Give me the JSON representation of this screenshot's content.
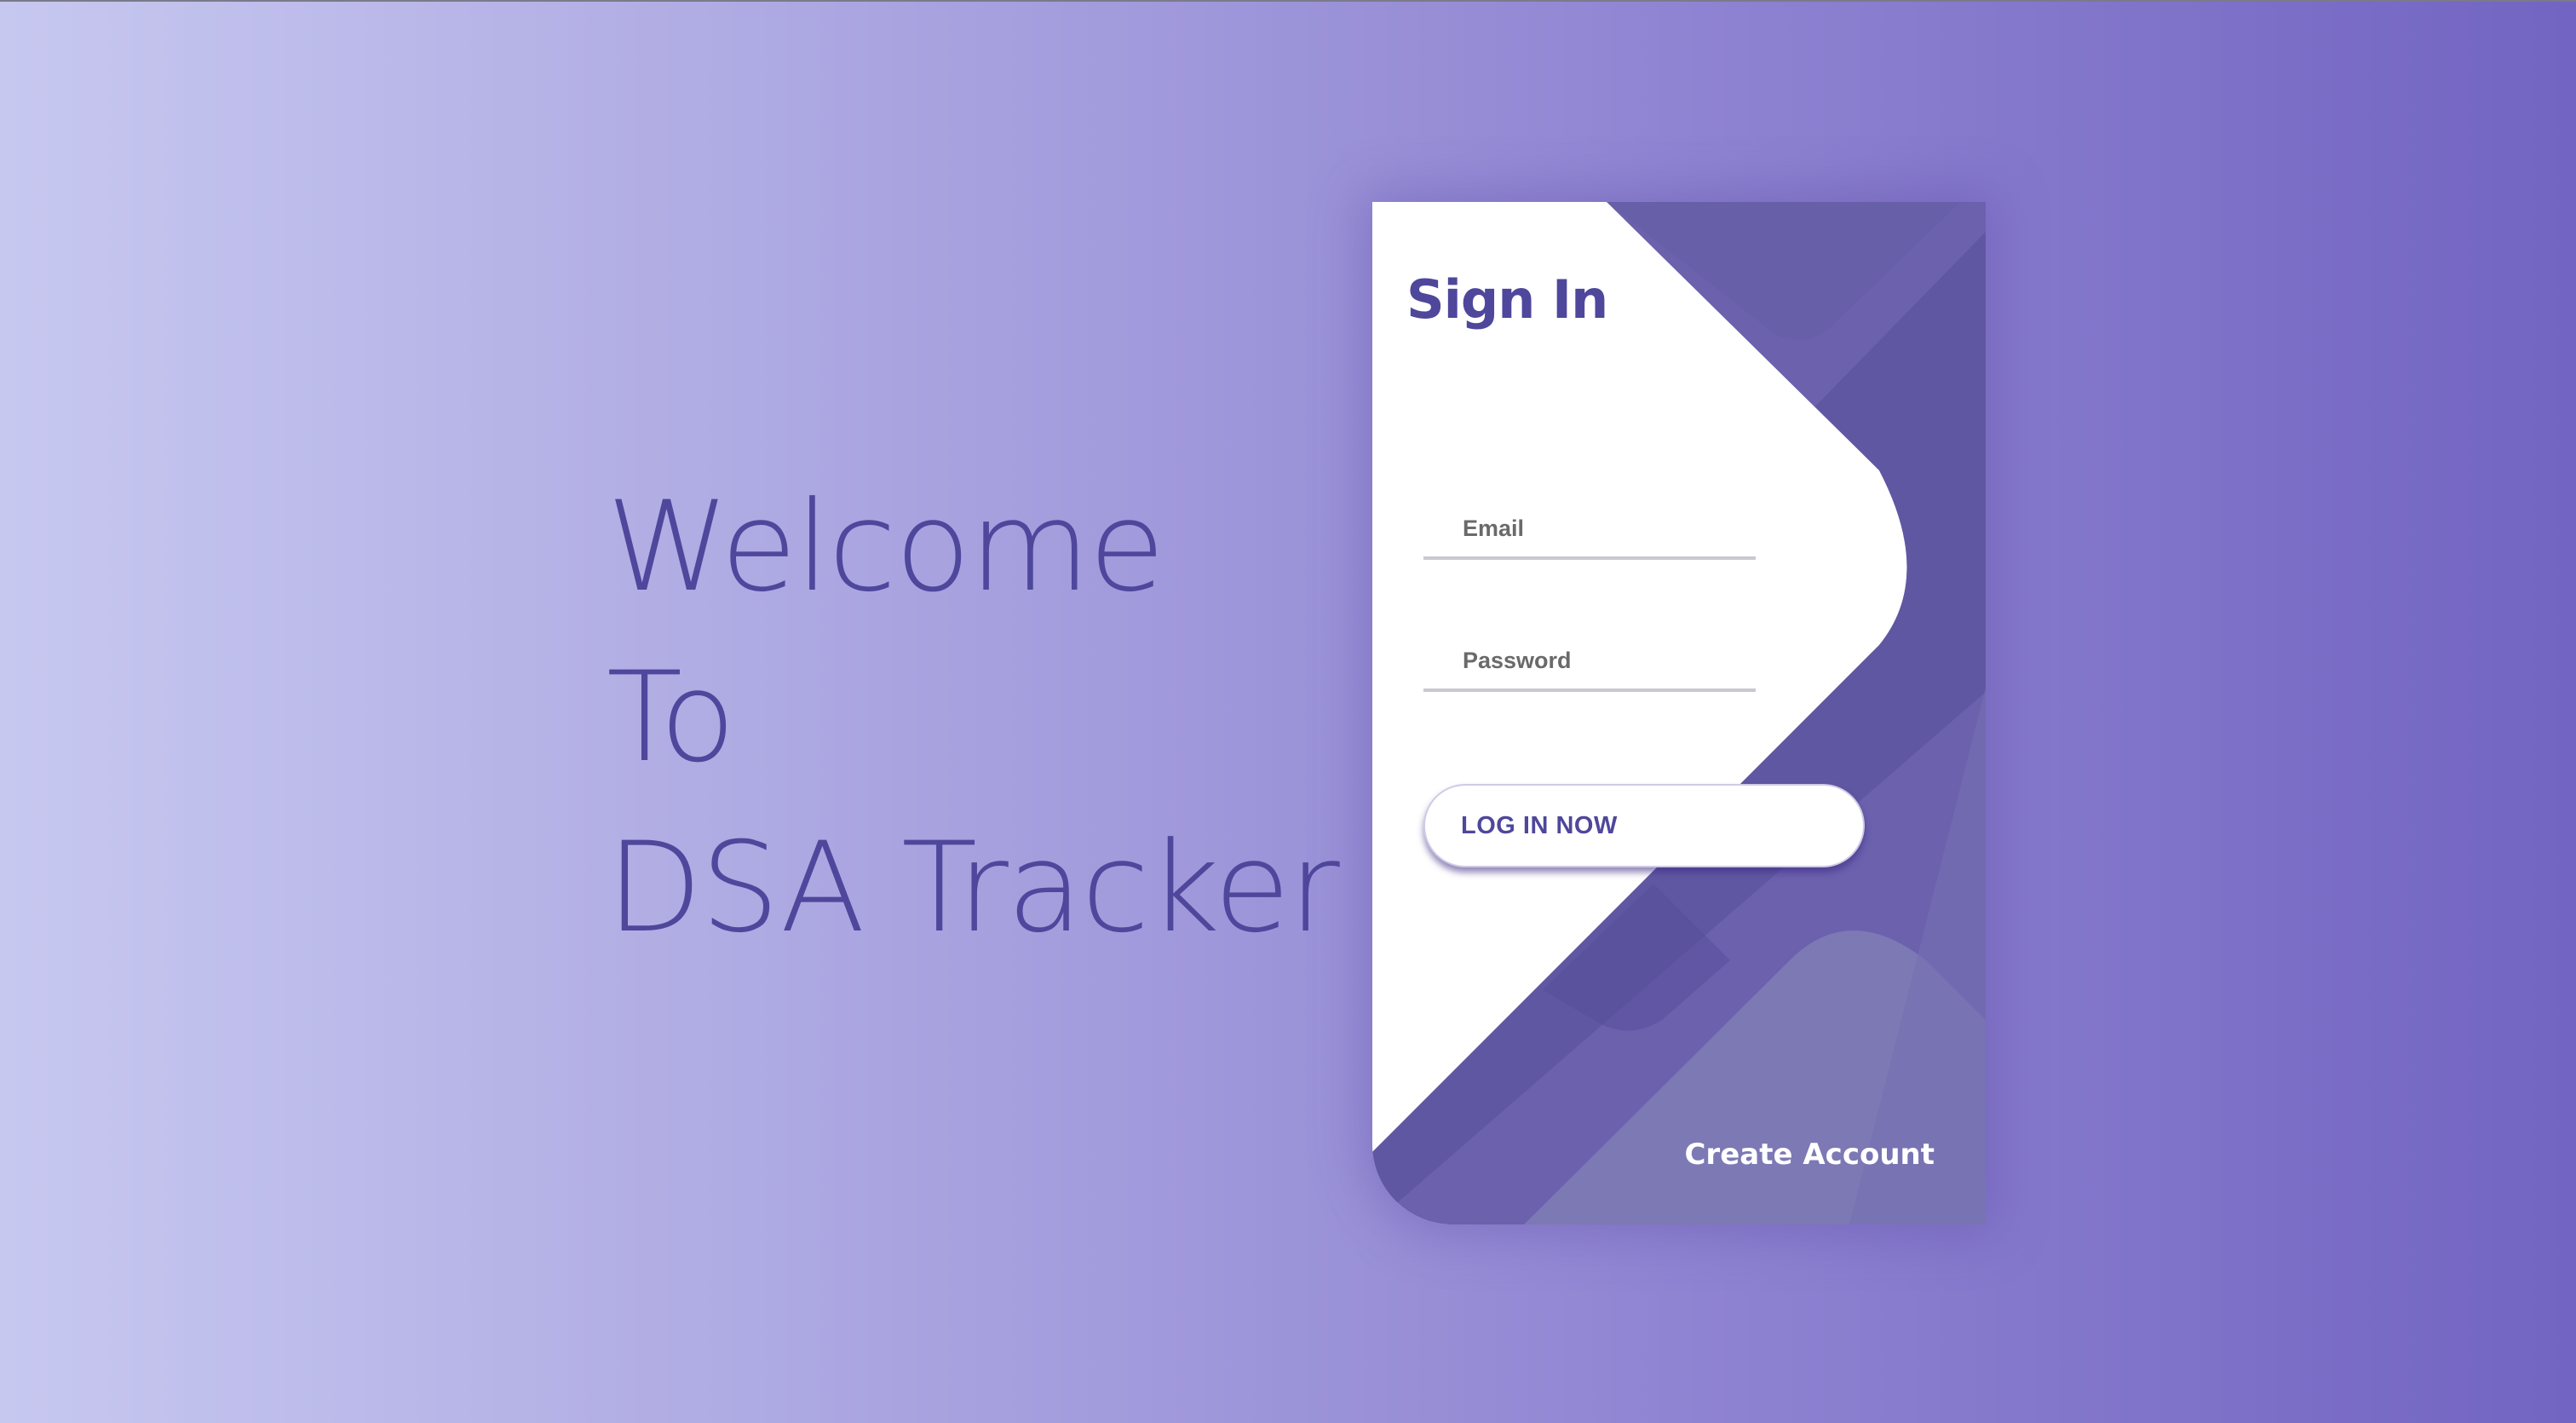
{
  "welcome": {
    "line1": "Welcome",
    "line2": "To",
    "line3": "DSA Tracker"
  },
  "login": {
    "title": "Sign In",
    "email_placeholder": "Email",
    "password_placeholder": "Password",
    "login_button_label": "LOG IN NOW",
    "create_account_label": "Create Account"
  },
  "colors": {
    "brand": "#4e479c",
    "background_light": "#c7c8f0",
    "background_dark": "#7264c2",
    "card_white": "#ffffff"
  }
}
